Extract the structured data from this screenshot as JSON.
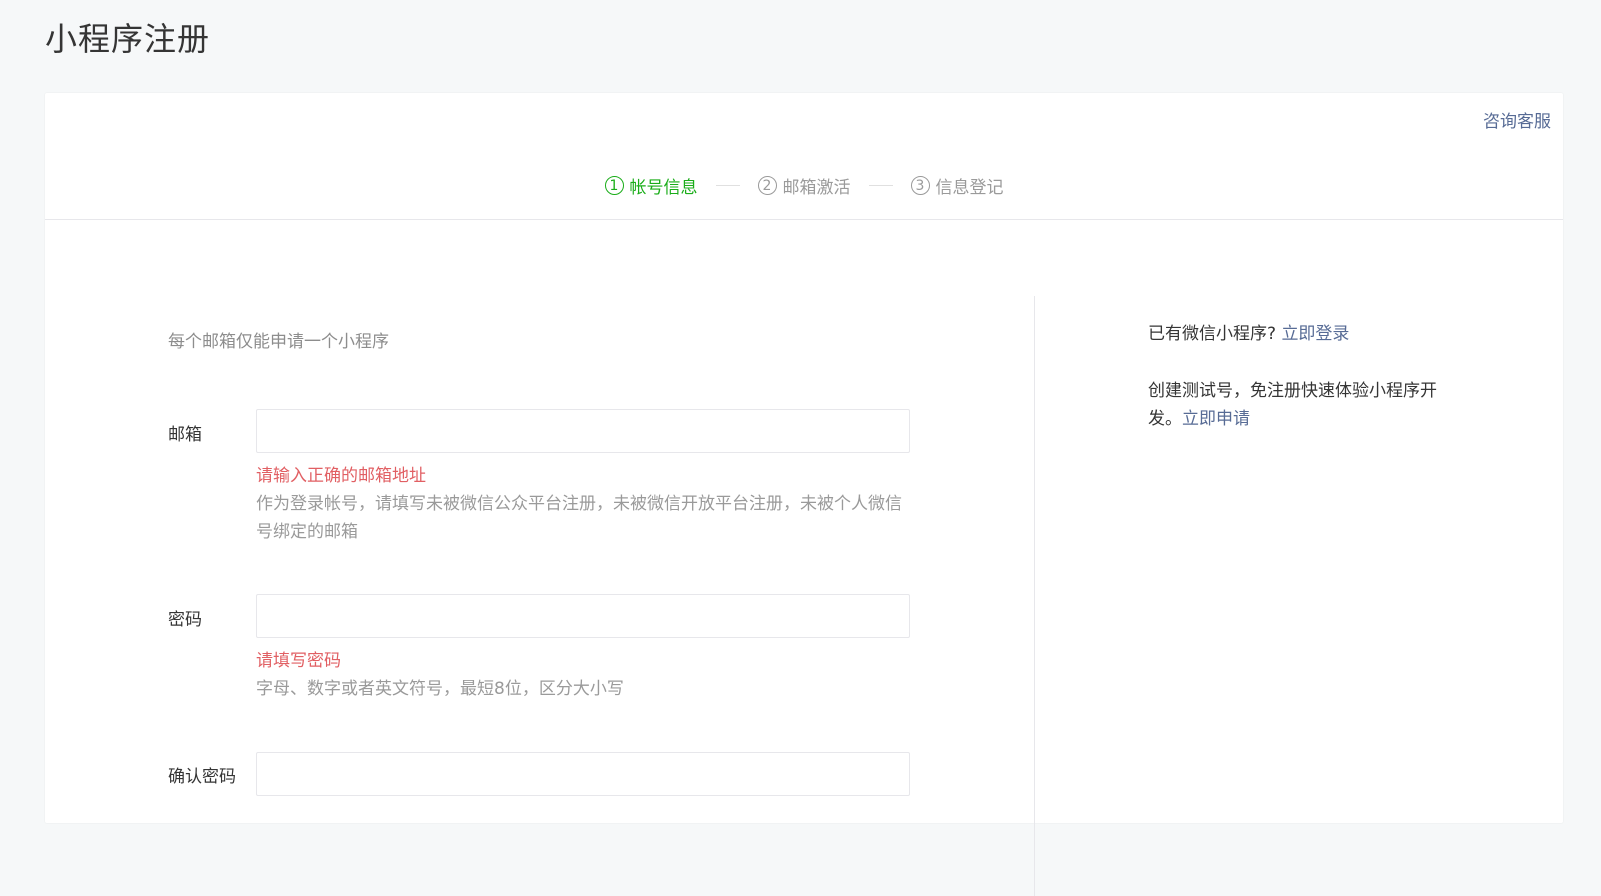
{
  "page": {
    "title": "小程序注册"
  },
  "header": {
    "consult_label": "咨询客服"
  },
  "steps": [
    {
      "num": "1",
      "label": "帐号信息",
      "active": true
    },
    {
      "num": "2",
      "label": "邮箱激活",
      "active": false
    },
    {
      "num": "3",
      "label": "信息登记",
      "active": false
    }
  ],
  "form": {
    "intro": "每个邮箱仅能申请一个小程序",
    "email": {
      "label": "邮箱",
      "value": "",
      "error": "请输入正确的邮箱地址",
      "tip": "作为登录帐号，请填写未被微信公众平台注册，未被微信开放平台注册，未被个人微信号绑定的邮箱"
    },
    "password": {
      "label": "密码",
      "value": "",
      "error": "请填写密码",
      "tip": "字母、数字或者英文符号，最短8位，区分大小写"
    },
    "confirm": {
      "label": "确认密码",
      "value": ""
    }
  },
  "sidebar": {
    "login_prompt": "已有微信小程序?",
    "login_link": "立即登录",
    "test_text": "创建测试号，免注册快速体验小程序开发。",
    "test_link": "立即申请"
  },
  "colors": {
    "accent_green": "#1aad19",
    "link_blue": "#576b95",
    "error_red": "#e15f63"
  }
}
